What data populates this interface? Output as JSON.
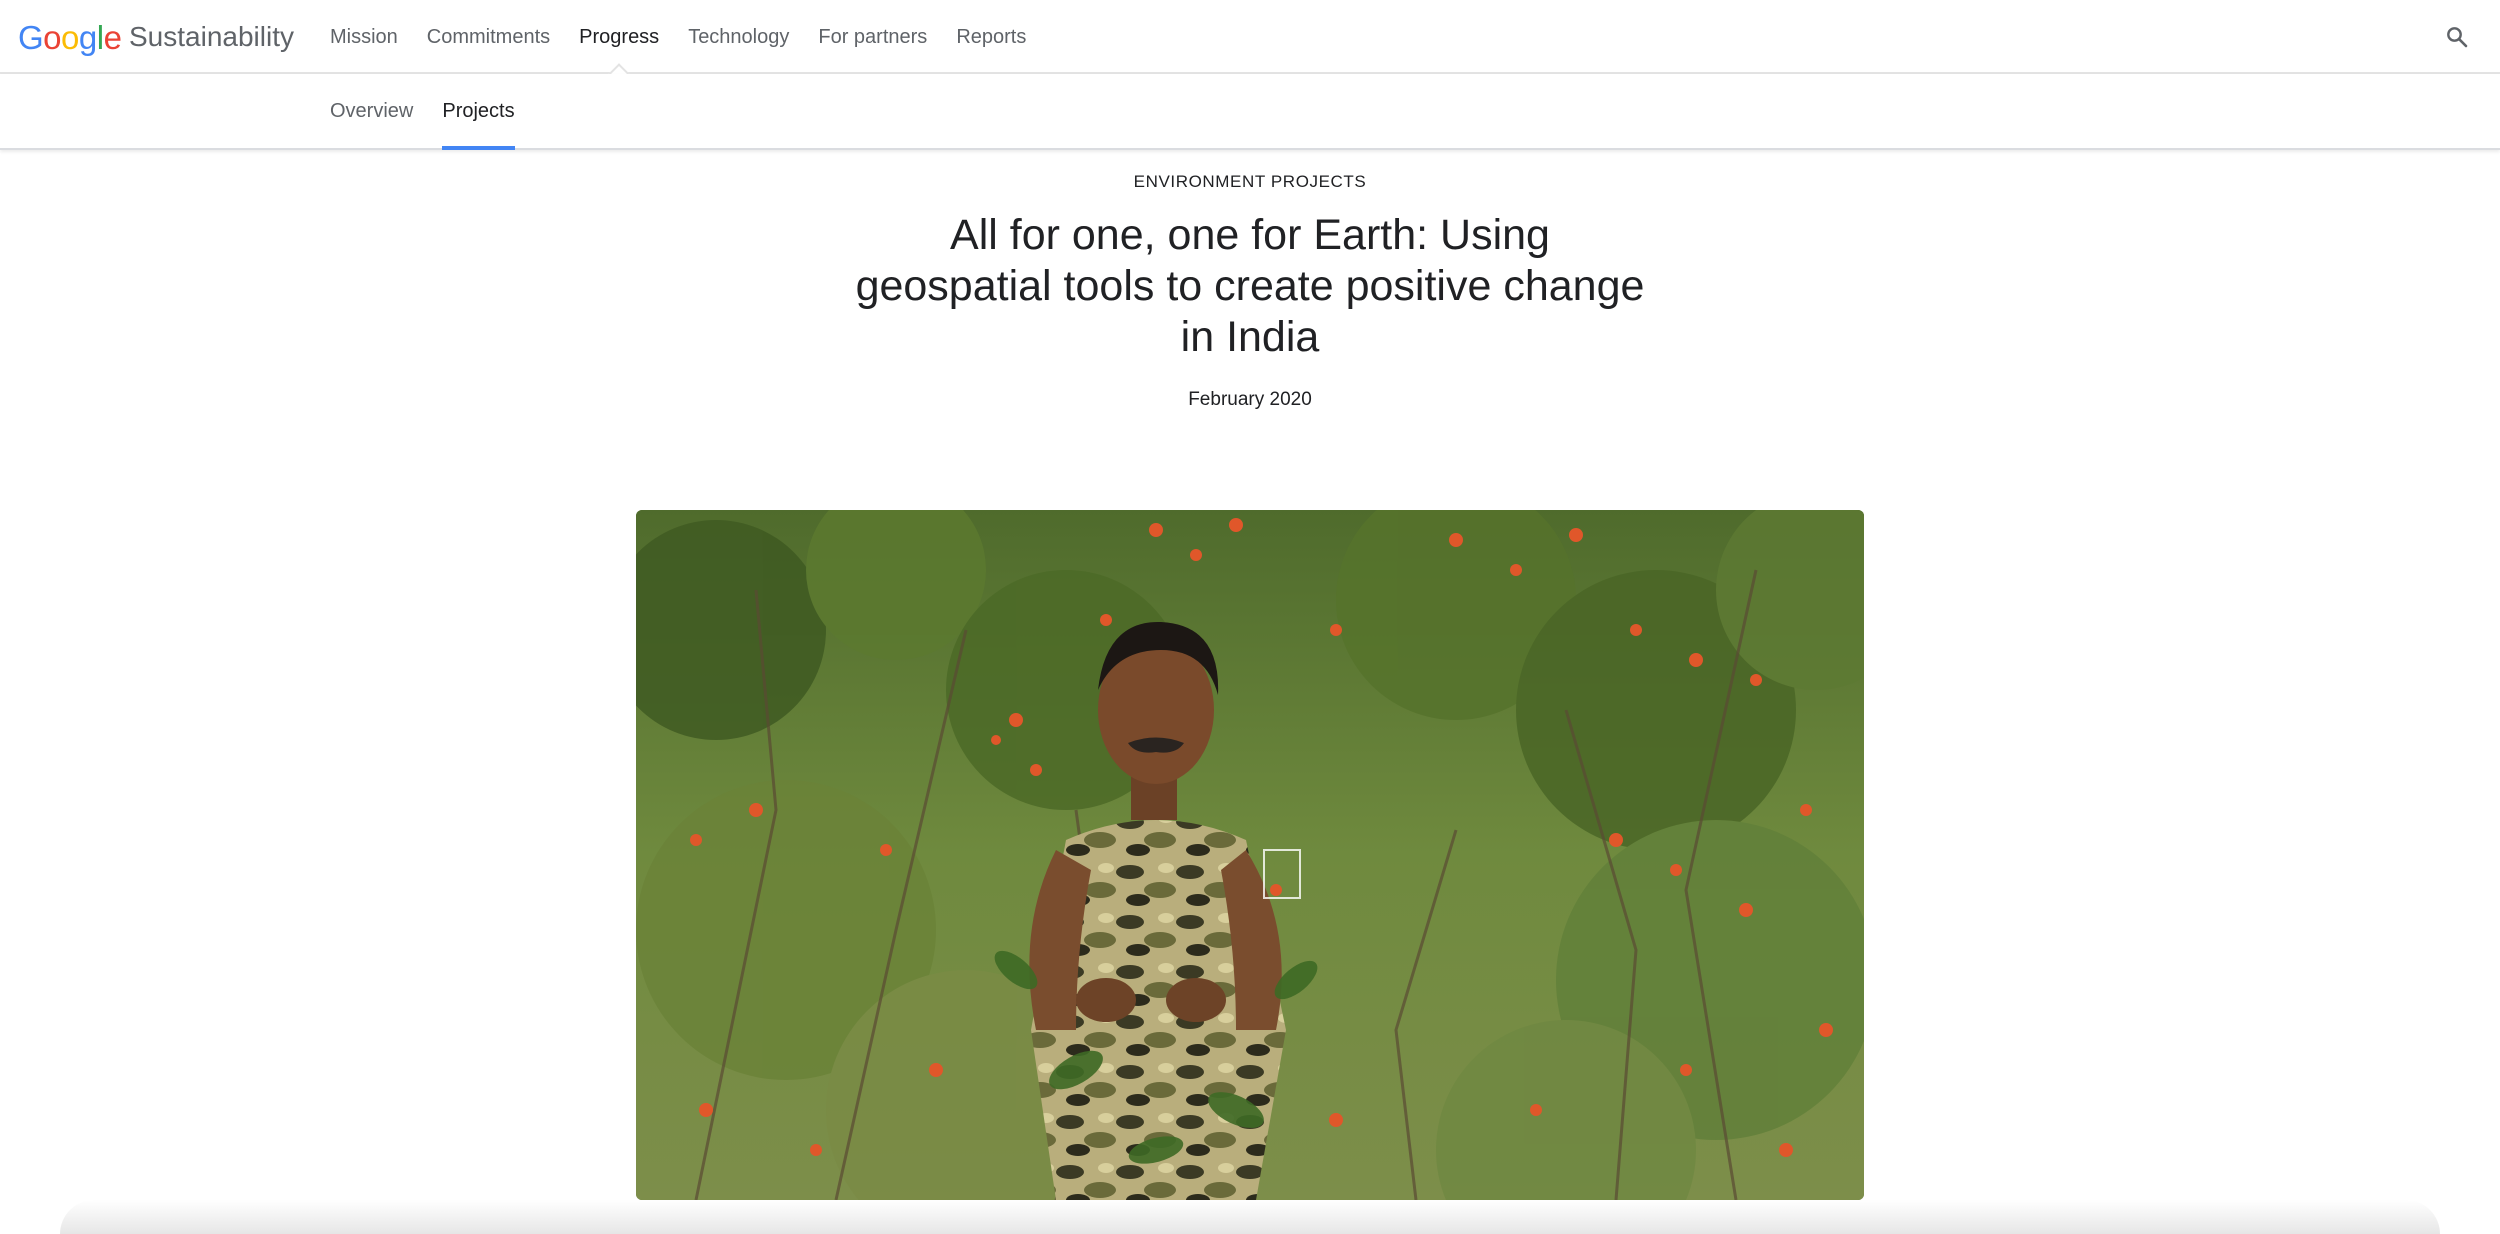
{
  "header": {
    "logo_text": "Google",
    "site_name": "Sustainability",
    "nav": [
      {
        "label": "Mission"
      },
      {
        "label": "Commitments"
      },
      {
        "label": "Progress",
        "active": true
      },
      {
        "label": "Technology"
      },
      {
        "label": "For partners"
      },
      {
        "label": "Reports"
      }
    ],
    "search_icon": "search-icon"
  },
  "subnav": {
    "items": [
      {
        "label": "Overview"
      },
      {
        "label": "Projects",
        "active": true
      }
    ],
    "accent_color": "#4285f4"
  },
  "article": {
    "eyebrow": "ENVIRONMENT PROJECTS",
    "title": "All for one, one for Earth: Using geospatial tools to create positive change in India",
    "date": "February 2020"
  },
  "colors": {
    "google_blue": "#4285f4",
    "google_red": "#ea4335",
    "google_yellow": "#fbbc05",
    "google_green": "#34a853",
    "text_primary": "#202124",
    "text_secondary": "#5f6368"
  }
}
